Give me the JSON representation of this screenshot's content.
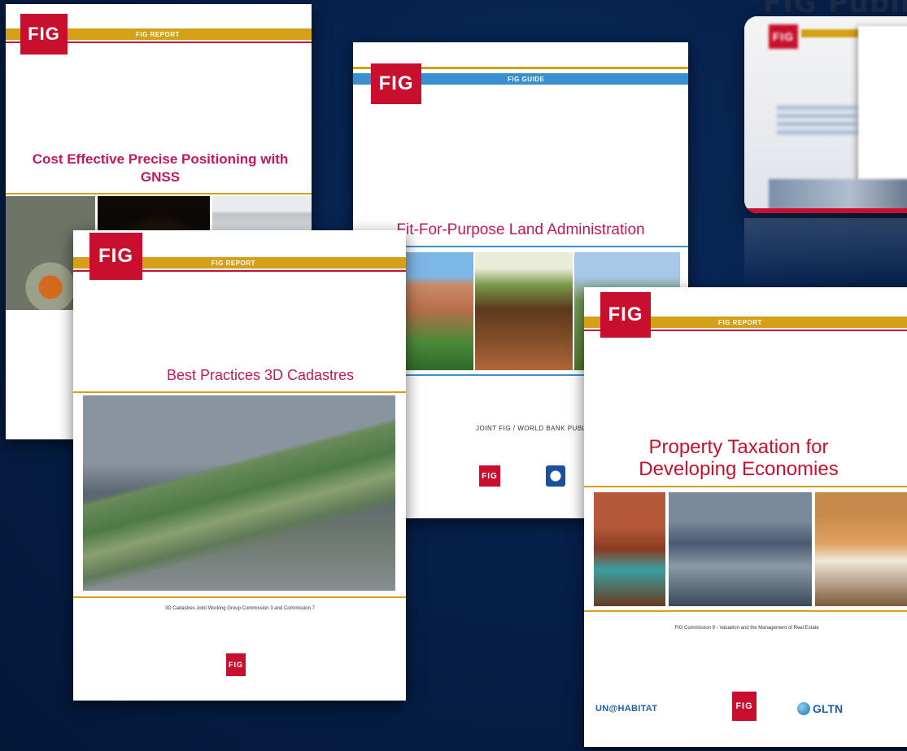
{
  "covers": {
    "gnss": {
      "logo": "FIG",
      "band_label": "FIG REPORT",
      "title": "Cost Effective Precise Positioning with GNSS"
    },
    "fit_for_purpose": {
      "logo": "FIG",
      "band_label": "FIG GUIDE",
      "title": "Fit-For-Purpose Land Administration",
      "footer": "JOINT FIG / WORLD BANK PUBLICATI"
    },
    "cadastres": {
      "logo": "FIG",
      "band_label": "FIG REPORT",
      "title": "Best Practices 3D Cadastres",
      "caption": "3D Cadastres Joint Working Group Commission 3 and Commission 7"
    },
    "taxation": {
      "logo": "FIG",
      "band_label": "FIG REPORT",
      "title": "Property Taxation for Developing Economies",
      "caption": "FIG Commission 9 - Valuation and the Management of Real Estate",
      "partners": [
        "UN@HABITAT",
        "FIG",
        "GLTN"
      ]
    }
  },
  "publications_panel": {
    "heading": "FIG Publi",
    "logo": "FIG"
  },
  "colors": {
    "fig_red": "#c8102e",
    "title_magenta": "#c2185b",
    "band_gold": "#d4a017",
    "band_blue": "#3a8fd0",
    "background_navy": "#06204a"
  }
}
